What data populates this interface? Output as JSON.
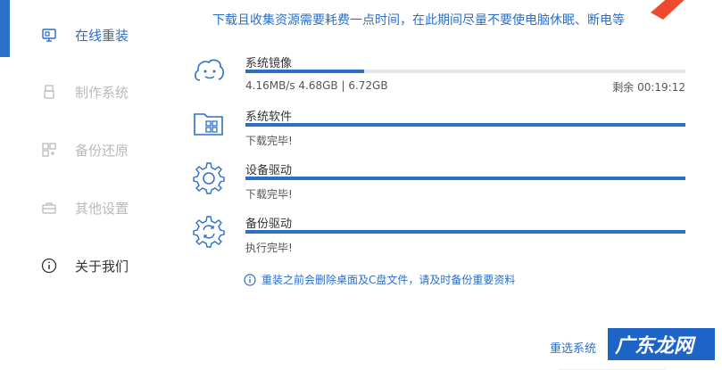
{
  "colors": {
    "accent": "#2a6fc8",
    "disabled": "#b9b9b9",
    "bar_track": "#e2e8f0",
    "arrow": "#f04a2e",
    "watermark_bg": "#1e63c6"
  },
  "sidebar": {
    "items": [
      {
        "label": "在线重装",
        "icon": "monitor-icon",
        "state": "active"
      },
      {
        "label": "制作系统",
        "icon": "usb-icon",
        "state": "disabled"
      },
      {
        "label": "备份还原",
        "icon": "backup-icon",
        "state": "disabled"
      },
      {
        "label": "其他设置",
        "icon": "toolbox-icon",
        "state": "disabled"
      },
      {
        "label": "关于我们",
        "icon": "info-circle-icon",
        "state": "normal"
      }
    ]
  },
  "main": {
    "top_message": "下载且收集资源需要耗费一点时间，在此期间尽量不要使电脑休眠、断电等",
    "tasks": [
      {
        "name": "系统镜像",
        "icon": "cloud-face-icon",
        "progress": 0.27,
        "status": "4.16MB/s 4.68GB | 6.72GB",
        "remaining": "剩余 00:19:12"
      },
      {
        "name": "系统软件",
        "icon": "folder-apps-icon",
        "progress": 1.0,
        "status": "下载完毕!"
      },
      {
        "name": "设备驱动",
        "icon": "gear-icon",
        "progress": 1.0,
        "status": "下载完毕!"
      },
      {
        "name": "备份驱动",
        "icon": "gear-sync-icon",
        "progress": 1.0,
        "status": "执行完毕!"
      }
    ],
    "notice": "重装之前会删除桌面及C盘文件，请及时备份重要资料",
    "reselect_label": "重选系统",
    "watermark_text": "广东龙网"
  }
}
